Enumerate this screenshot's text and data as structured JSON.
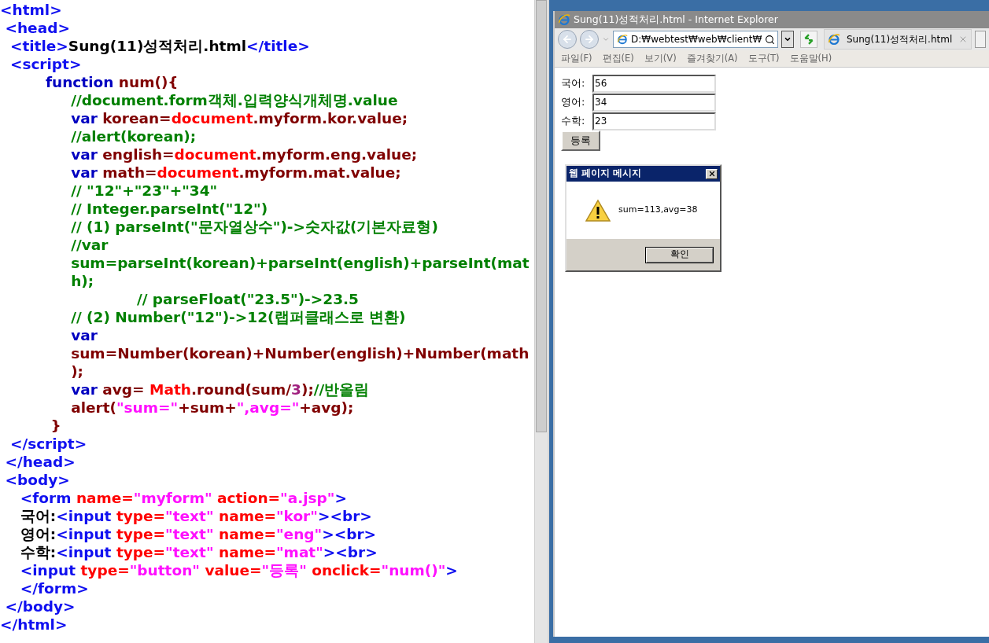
{
  "editor": {
    "lines": [
      {
        "tokens": [
          {
            "kind": "tag",
            "text": "<html>"
          }
        ]
      },
      {
        "tokens": [
          {
            "kind": "tag",
            "text": " <head>"
          }
        ]
      },
      {
        "tokens": [
          {
            "kind": "tag",
            "text": "  <title>"
          },
          {
            "kind": "plain",
            "text": "Sung(11)성적처리.html"
          },
          {
            "kind": "tag",
            "text": "</title>"
          }
        ]
      },
      {
        "tokens": [
          {
            "kind": "tag",
            "text": "  <script>"
          }
        ]
      },
      {
        "tokens": [
          {
            "kind": "keyword",
            "text": "         function "
          },
          {
            "kind": "ident",
            "text": "num(){"
          }
        ]
      },
      {
        "tokens": [
          {
            "kind": "comment",
            "text": "              //document.form객체.입력양식개체명.value"
          }
        ]
      },
      {
        "tokens": [
          {
            "kind": "keyword",
            "text": "              var "
          },
          {
            "kind": "ident",
            "text": "korean="
          },
          {
            "kind": "object",
            "text": "document"
          },
          {
            "kind": "ident",
            "text": ".myform.kor.value;"
          }
        ]
      },
      {
        "tokens": [
          {
            "kind": "comment",
            "text": "              //alert(korean);"
          }
        ]
      },
      {
        "tokens": [
          {
            "kind": "keyword",
            "text": "              var "
          },
          {
            "kind": "ident",
            "text": "english="
          },
          {
            "kind": "object",
            "text": "document"
          },
          {
            "kind": "ident",
            "text": ".myform.eng.value;"
          }
        ]
      },
      {
        "tokens": [
          {
            "kind": "keyword",
            "text": "              var "
          },
          {
            "kind": "ident",
            "text": "math="
          },
          {
            "kind": "object",
            "text": "document"
          },
          {
            "kind": "ident",
            "text": ".myform.mat.value;"
          }
        ]
      },
      {
        "tokens": [
          {
            "kind": "comment",
            "text": "              // \"12\"+\"23\"+\"34\""
          }
        ]
      },
      {
        "tokens": [
          {
            "kind": "comment",
            "text": "              // Integer.parseInt(\"12\")"
          }
        ]
      },
      {
        "tokens": [
          {
            "kind": "comment",
            "text": "              // (1) parseInt(\"문자열상수\")->숫자값(기본자료형)"
          }
        ]
      },
      {
        "tokens": [
          {
            "kind": "comment",
            "text": "              //var"
          }
        ]
      },
      {
        "tokens": [
          {
            "kind": "comment",
            "text": "              sum=parseInt(korean)+parseInt(english)+parseInt(mat"
          }
        ]
      },
      {
        "tokens": [
          {
            "kind": "comment",
            "text": "              h);"
          }
        ]
      },
      {
        "tokens": [
          {
            "kind": "comment",
            "text": "                           // parseFloat(\"23.5\")->23.5"
          }
        ]
      },
      {
        "tokens": [
          {
            "kind": "comment",
            "text": "              // (2) Number(\"12\")->12(랩퍼클래스로 변환)"
          }
        ]
      },
      {
        "tokens": [
          {
            "kind": "keyword",
            "text": "              var"
          }
        ]
      },
      {
        "tokens": [
          {
            "kind": "ident",
            "text": "              sum=Number(korean)+Number(english)+Number(math"
          }
        ]
      },
      {
        "tokens": [
          {
            "kind": "ident",
            "text": "              );"
          }
        ]
      },
      {
        "tokens": [
          {
            "kind": "keyword",
            "text": "              var "
          },
          {
            "kind": "ident",
            "text": "avg= "
          },
          {
            "kind": "object",
            "text": "Math"
          },
          {
            "kind": "ident",
            "text": ".round(sum/"
          },
          {
            "kind": "number",
            "text": "3"
          },
          {
            "kind": "ident",
            "text": ");"
          },
          {
            "kind": "comment",
            "text": "//반올림"
          }
        ]
      },
      {
        "tokens": [
          {
            "kind": "ident",
            "text": "              alert("
          },
          {
            "kind": "string",
            "text": "\"sum=\""
          },
          {
            "kind": "ident",
            "text": "+sum+"
          },
          {
            "kind": "string",
            "text": "\",avg=\""
          },
          {
            "kind": "ident",
            "text": "+avg);"
          }
        ]
      },
      {
        "tokens": [
          {
            "kind": "ident",
            "text": "          }"
          }
        ]
      },
      {
        "tokens": [
          {
            "kind": "tag",
            "text": "  </script>"
          }
        ]
      },
      {
        "tokens": [
          {
            "kind": "tag",
            "text": " </head>"
          }
        ]
      },
      {
        "tokens": [
          {
            "kind": "tag",
            "text": " <body>"
          }
        ]
      },
      {
        "tokens": [
          {
            "kind": "tag",
            "text": "    <form "
          },
          {
            "kind": "attr",
            "text": "name="
          },
          {
            "kind": "string",
            "text": "\"myform\" "
          },
          {
            "kind": "attr",
            "text": "action="
          },
          {
            "kind": "string",
            "text": "\"a.jsp\""
          },
          {
            "kind": "tag",
            "text": ">"
          }
        ]
      },
      {
        "tokens": [
          {
            "kind": "plain",
            "text": "    국어:"
          },
          {
            "kind": "tag",
            "text": "<input "
          },
          {
            "kind": "attr",
            "text": "type="
          },
          {
            "kind": "string",
            "text": "\"text\" "
          },
          {
            "kind": "attr",
            "text": "name="
          },
          {
            "kind": "string",
            "text": "\"kor\""
          },
          {
            "kind": "tag",
            "text": "><br>"
          }
        ]
      },
      {
        "tokens": [
          {
            "kind": "plain",
            "text": "    영어:"
          },
          {
            "kind": "tag",
            "text": "<input "
          },
          {
            "kind": "attr",
            "text": "type="
          },
          {
            "kind": "string",
            "text": "\"text\" "
          },
          {
            "kind": "attr",
            "text": "name="
          },
          {
            "kind": "string",
            "text": "\"eng\""
          },
          {
            "kind": "tag",
            "text": "><br>"
          }
        ]
      },
      {
        "tokens": [
          {
            "kind": "plain",
            "text": "    수학:"
          },
          {
            "kind": "tag",
            "text": "<input "
          },
          {
            "kind": "attr",
            "text": "type="
          },
          {
            "kind": "string",
            "text": "\"text\" "
          },
          {
            "kind": "attr",
            "text": "name="
          },
          {
            "kind": "string",
            "text": "\"mat\""
          },
          {
            "kind": "tag",
            "text": "><br>"
          }
        ]
      },
      {
        "tokens": [
          {
            "kind": "tag",
            "text": "    <input "
          },
          {
            "kind": "attr",
            "text": "type="
          },
          {
            "kind": "string",
            "text": "\"button\" "
          },
          {
            "kind": "attr",
            "text": "value="
          },
          {
            "kind": "string",
            "text": "\"등록\" "
          },
          {
            "kind": "attr",
            "text": "onclick="
          },
          {
            "kind": "string",
            "text": "\"num()\""
          },
          {
            "kind": "tag",
            "text": ">"
          }
        ]
      },
      {
        "tokens": [
          {
            "kind": "tag",
            "text": "    </form>"
          }
        ]
      },
      {
        "tokens": [
          {
            "kind": "tag",
            "text": " </body>"
          }
        ]
      },
      {
        "tokens": [
          {
            "kind": "tag",
            "text": "</html>"
          }
        ]
      }
    ]
  },
  "browser": {
    "title": "Sung(11)성적처리.html - Internet Explorer",
    "address": "D:₩webtest₩web₩client₩",
    "tab": "Sung(11)성적처리.html",
    "menu": [
      "파일(F)",
      "편집(E)",
      "보기(V)",
      "즐겨찾기(A)",
      "도구(T)",
      "도움말(H)"
    ],
    "form": {
      "fields": [
        {
          "label": "국어:",
          "value": "56"
        },
        {
          "label": "영어:",
          "value": "34"
        },
        {
          "label": "수학:",
          "value": "23"
        }
      ],
      "button": "등록"
    },
    "dialog": {
      "title": "웹 페이지 메시지",
      "message": "sum=113,avg=38",
      "button": "확인"
    }
  }
}
